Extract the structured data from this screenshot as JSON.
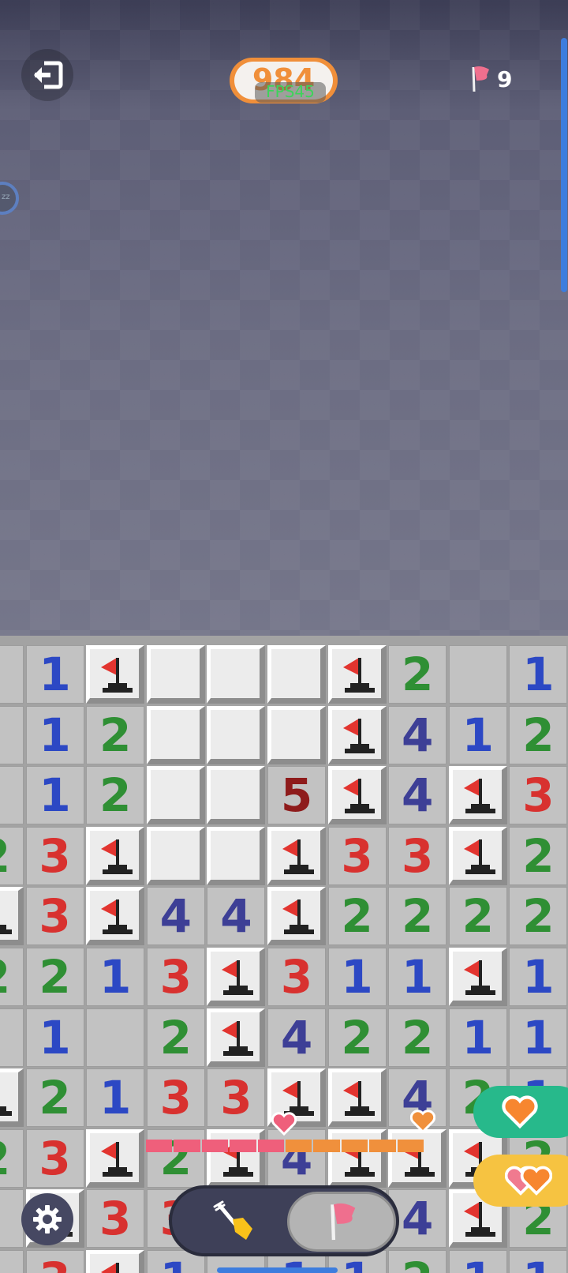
{
  "header": {
    "score": "984",
    "fps": "FPS45",
    "flags_left": "9",
    "exit_icon": "exit-icon",
    "flag_icon": "flag-icon"
  },
  "side_avatar": {
    "text": "zz"
  },
  "colors": {
    "1": "#2c48c4",
    "2": "#2f8f34",
    "3": "#d8312f",
    "4": "#3d3f96",
    "5": "#8e1b1b",
    "flag": "#e2342f",
    "accent_orange": "#f08f3a",
    "progress_pink": "#ef5f7b",
    "progress_orange": "#f0903c"
  },
  "board": {
    "rows": [
      [
        "o",
        "1",
        "F",
        "C",
        "C",
        "C",
        "F",
        "2",
        "o",
        "1"
      ],
      [
        "o",
        "1",
        "2",
        "C",
        "C",
        "C",
        "F",
        "4",
        "1",
        "2"
      ],
      [
        "o",
        "1",
        "2",
        "C",
        "C",
        "5",
        "F",
        "4",
        "F",
        "3"
      ],
      [
        "2",
        "3",
        "F",
        "C",
        "C",
        "F",
        "3",
        "3",
        "F",
        "2"
      ],
      [
        "F",
        "3",
        "F",
        "4",
        "4",
        "F",
        "2",
        "2",
        "2",
        "2"
      ],
      [
        "2",
        "2",
        "1",
        "3",
        "F",
        "3",
        "1",
        "1",
        "F",
        "1"
      ],
      [
        "o",
        "1",
        "o",
        "2",
        "F",
        "4",
        "2",
        "2",
        "1",
        "1"
      ],
      [
        "F",
        "2",
        "1",
        "3",
        "3",
        "F",
        "F",
        "4",
        "2",
        "1"
      ],
      [
        "2",
        "3",
        "F",
        "2",
        "F",
        "4",
        "F",
        "F",
        "F",
        "2"
      ],
      [
        "o",
        "F",
        "3",
        "3",
        "o",
        "1",
        "o",
        "4",
        "F",
        "2"
      ],
      [
        "o",
        "3",
        "F",
        "1",
        "o",
        "1",
        "1",
        "2",
        "1",
        "1"
      ]
    ]
  },
  "progress": {
    "pink_segments": 5,
    "orange_segments": 5,
    "pink_marker_icon": "heart-icon",
    "orange_marker_icon": "heart-icon"
  },
  "reactions": [
    {
      "name": "orange-heart-reaction",
      "icon": "heart-icon"
    },
    {
      "name": "double-heart-reaction",
      "icon": "two-hearts-icon"
    }
  ],
  "controls": {
    "settings_icon": "gear-icon",
    "dig_icon": "shovel-icon",
    "flag_icon": "flag-icon",
    "active_mode": "flag"
  }
}
